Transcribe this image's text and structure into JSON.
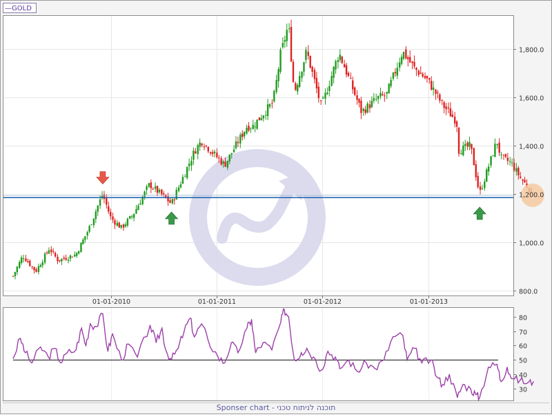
{
  "legend": {
    "symbol": "—",
    "label": "GOLD",
    "color": "#5a3a9a"
  },
  "footer": {
    "text": "Sponser chart - תוכנה לניתוח טכני"
  },
  "colors": {
    "up": "#1e9b1e",
    "down": "#e02020",
    "support": "#1a5fa8",
    "rsi": "#9b3fa8",
    "arrow_down": "#e8594a",
    "arrow_up": "#3a9a4a",
    "highlight": "#f6c9a0",
    "watermark": "#d8d8ec"
  },
  "chart_data": [
    {
      "type": "candlestick",
      "title": "GOLD",
      "x_range": [
        "2009-01-26",
        "2013-08-31"
      ],
      "ylim": [
        780,
        1940
      ],
      "x_ticks": [
        {
          "date": "2010-01-01",
          "label": "01-01-2010"
        },
        {
          "date": "2011-01-01",
          "label": "01-01-2011"
        },
        {
          "date": "2012-01-01",
          "label": "01-01-2012"
        },
        {
          "date": "2013-01-01",
          "label": "01-01-2013"
        }
      ],
      "y_ticks": [
        {
          "value": 800,
          "label": "800.0"
        },
        {
          "value": 1000,
          "label": "1,000.0"
        },
        {
          "value": 1200,
          "label": "1,200.0"
        },
        {
          "value": 1400,
          "label": "1,400.0"
        },
        {
          "value": 1600,
          "label": "1,600.0"
        },
        {
          "value": 1800,
          "label": "1,800.0"
        }
      ],
      "close_path": [
        [
          "2009-01-26",
          860
        ],
        [
          "2009-03-01",
          945
        ],
        [
          "2009-04-15",
          880
        ],
        [
          "2009-06-01",
          975
        ],
        [
          "2009-07-01",
          925
        ],
        [
          "2009-09-01",
          950
        ],
        [
          "2009-10-15",
          1055
        ],
        [
          "2009-12-02",
          1200
        ],
        [
          "2009-12-31",
          1100
        ],
        [
          "2010-02-05",
          1060
        ],
        [
          "2010-03-15",
          1110
        ],
        [
          "2010-05-13",
          1240
        ],
        [
          "2010-07-01",
          1190
        ],
        [
          "2010-07-28",
          1160
        ],
        [
          "2010-10-15",
          1375
        ],
        [
          "2010-11-09",
          1420
        ],
        [
          "2011-01-28",
          1320
        ],
        [
          "2011-04-15",
          1480
        ],
        [
          "2011-05-05",
          1480
        ],
        [
          "2011-07-15",
          1580
        ],
        [
          "2011-08-10",
          1780
        ],
        [
          "2011-09-06",
          1900
        ],
        [
          "2011-09-26",
          1620
        ],
        [
          "2011-11-08",
          1790
        ],
        [
          "2011-12-29",
          1560
        ],
        [
          "2012-02-28",
          1785
        ],
        [
          "2012-05-16",
          1540
        ],
        [
          "2012-07-15",
          1600
        ],
        [
          "2012-08-10",
          1610
        ],
        [
          "2012-10-05",
          1790
        ],
        [
          "2012-11-15",
          1720
        ],
        [
          "2012-12-31",
          1670
        ],
        [
          "2013-02-20",
          1570
        ],
        [
          "2013-04-10",
          1500
        ],
        [
          "2013-04-16",
          1380
        ],
        [
          "2013-05-28",
          1400
        ],
        [
          "2013-06-28",
          1200
        ],
        [
          "2013-08-27",
          1420
        ],
        [
          "2013-09-10",
          1350
        ],
        [
          "2013-10-15",
          1330
        ],
        [
          "2013-11-15",
          1270
        ],
        [
          "2013-12-31",
          1200
        ]
      ],
      "support_line": 1185,
      "annotations": [
        {
          "type": "arrow-down",
          "date": "2009-12-02",
          "value": 1230
        },
        {
          "type": "arrow-up",
          "date": "2010-07-28",
          "value": 1160
        },
        {
          "type": "arrow-up",
          "date": "2013-06-28",
          "value": 1180
        },
        {
          "type": "highlight-circle",
          "date": "2013-12-28",
          "value": 1195
        }
      ]
    },
    {
      "type": "line",
      "name": "RSI",
      "ylim": [
        22,
        86
      ],
      "y_ticks": [
        {
          "value": 30,
          "label": "30"
        },
        {
          "value": 40,
          "label": "40"
        },
        {
          "value": 50,
          "label": "50"
        },
        {
          "value": 60,
          "label": "60"
        },
        {
          "value": 70,
          "label": "70"
        },
        {
          "value": 80,
          "label": "80"
        }
      ],
      "reference_line": 50,
      "series": [
        {
          "x": "2009-01-26",
          "y": 51
        },
        {
          "x": "2009-02-20",
          "y": 65
        },
        {
          "x": "2009-03-10",
          "y": 55
        },
        {
          "x": "2009-04-01",
          "y": 48
        },
        {
          "x": "2009-05-01",
          "y": 59
        },
        {
          "x": "2009-05-28",
          "y": 52
        },
        {
          "x": "2009-06-20",
          "y": 58
        },
        {
          "x": "2009-07-10",
          "y": 48
        },
        {
          "x": "2009-08-01",
          "y": 55
        },
        {
          "x": "2009-09-01",
          "y": 57
        },
        {
          "x": "2009-09-20",
          "y": 72
        },
        {
          "x": "2009-10-05",
          "y": 60
        },
        {
          "x": "2009-10-20",
          "y": 75
        },
        {
          "x": "2009-11-10",
          "y": 73
        },
        {
          "x": "2009-12-02",
          "y": 82
        },
        {
          "x": "2009-12-20",
          "y": 56
        },
        {
          "x": "2010-01-05",
          "y": 68
        },
        {
          "x": "2010-02-05",
          "y": 50
        },
        {
          "x": "2010-03-01",
          "y": 61
        },
        {
          "x": "2010-04-01",
          "y": 52
        },
        {
          "x": "2010-05-15",
          "y": 74
        },
        {
          "x": "2010-06-05",
          "y": 62
        },
        {
          "x": "2010-06-25",
          "y": 72
        },
        {
          "x": "2010-07-10",
          "y": 56
        },
        {
          "x": "2010-07-28",
          "y": 50
        },
        {
          "x": "2010-08-20",
          "y": 58
        },
        {
          "x": "2010-09-10",
          "y": 70
        },
        {
          "x": "2010-10-01",
          "y": 79
        },
        {
          "x": "2010-10-15",
          "y": 66
        },
        {
          "x": "2010-11-09",
          "y": 75
        },
        {
          "x": "2010-12-01",
          "y": 64
        },
        {
          "x": "2011-01-05",
          "y": 52
        },
        {
          "x": "2011-01-28",
          "y": 48
        },
        {
          "x": "2011-02-20",
          "y": 62
        },
        {
          "x": "2011-03-15",
          "y": 55
        },
        {
          "x": "2011-04-15",
          "y": 72
        },
        {
          "x": "2011-05-01",
          "y": 78
        },
        {
          "x": "2011-05-15",
          "y": 55
        },
        {
          "x": "2011-06-10",
          "y": 62
        },
        {
          "x": "2011-07-10",
          "y": 57
        },
        {
          "x": "2011-08-10",
          "y": 76
        },
        {
          "x": "2011-08-22",
          "y": 85
        },
        {
          "x": "2011-09-06",
          "y": 80
        },
        {
          "x": "2011-09-26",
          "y": 50
        },
        {
          "x": "2011-10-20",
          "y": 55
        },
        {
          "x": "2011-11-08",
          "y": 58
        },
        {
          "x": "2011-12-01",
          "y": 52
        },
        {
          "x": "2011-12-29",
          "y": 43
        },
        {
          "x": "2012-01-20",
          "y": 56
        },
        {
          "x": "2012-02-15",
          "y": 52
        },
        {
          "x": "2012-03-01",
          "y": 44
        },
        {
          "x": "2012-04-01",
          "y": 50
        },
        {
          "x": "2012-05-01",
          "y": 42
        },
        {
          "x": "2012-06-01",
          "y": 48
        },
        {
          "x": "2012-07-01",
          "y": 44
        },
        {
          "x": "2012-08-01",
          "y": 50
        },
        {
          "x": "2012-09-01",
          "y": 66
        },
        {
          "x": "2012-10-05",
          "y": 67
        },
        {
          "x": "2012-10-20",
          "y": 50
        },
        {
          "x": "2012-11-15",
          "y": 58
        },
        {
          "x": "2012-12-10",
          "y": 48
        },
        {
          "x": "2013-01-10",
          "y": 50
        },
        {
          "x": "2013-02-01",
          "y": 38
        },
        {
          "x": "2013-02-20",
          "y": 33
        },
        {
          "x": "2013-03-15",
          "y": 40
        },
        {
          "x": "2013-04-12",
          "y": 24
        },
        {
          "x": "2013-05-01",
          "y": 33
        },
        {
          "x": "2013-05-28",
          "y": 30
        },
        {
          "x": "2013-06-15",
          "y": 26
        },
        {
          "x": "2013-06-28",
          "y": 24
        },
        {
          "x": "2013-07-28",
          "y": 45
        },
        {
          "x": "2013-08-27",
          "y": 47
        },
        {
          "x": "2013-09-10",
          "y": 35
        },
        {
          "x": "2013-10-01",
          "y": 45
        },
        {
          "x": "2013-10-20",
          "y": 37
        },
        {
          "x": "2013-11-15",
          "y": 36
        },
        {
          "x": "2013-12-10",
          "y": 34
        },
        {
          "x": "2013-12-31",
          "y": 35
        }
      ]
    }
  ]
}
